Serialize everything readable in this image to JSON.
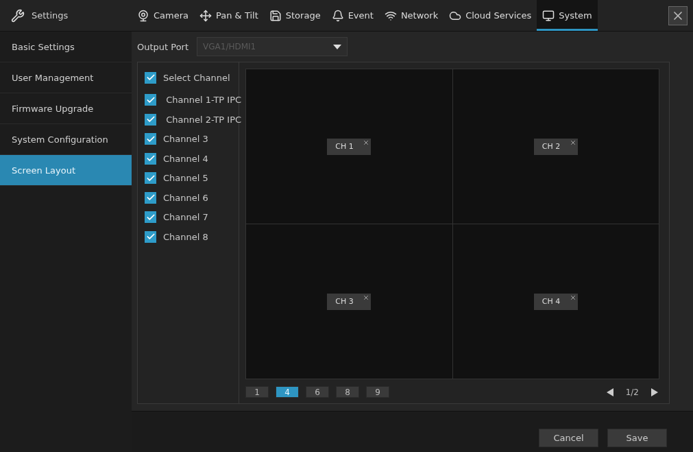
{
  "header": {
    "title": "Settings",
    "tabs": [
      {
        "label": "Camera",
        "selected": false
      },
      {
        "label": "Pan & Tilt",
        "selected": false
      },
      {
        "label": "Storage",
        "selected": false
      },
      {
        "label": "Event",
        "selected": false
      },
      {
        "label": "Network",
        "selected": false
      },
      {
        "label": "Cloud Services",
        "selected": false
      },
      {
        "label": "System",
        "selected": true
      }
    ]
  },
  "sidebar": {
    "items": [
      {
        "label": "Basic Settings",
        "selected": false
      },
      {
        "label": "User Management",
        "selected": false
      },
      {
        "label": "Firmware Upgrade",
        "selected": false
      },
      {
        "label": "System Configuration",
        "selected": false
      },
      {
        "label": "Screen Layout",
        "selected": true
      }
    ]
  },
  "output_port": {
    "label": "Output Port",
    "value": "VGA1/HDMI1",
    "disabled": true
  },
  "select_channel": {
    "label": "Select Channel",
    "checked": true
  },
  "channels": [
    {
      "label": " Channel 1-TP IPC",
      "checked": true
    },
    {
      "label": " Channel 2-TP IPC",
      "checked": true
    },
    {
      "label": "Channel 3",
      "checked": true
    },
    {
      "label": "Channel 4",
      "checked": true
    },
    {
      "label": "Channel 5",
      "checked": true
    },
    {
      "label": "Channel 6",
      "checked": true
    },
    {
      "label": "Channel 7",
      "checked": true
    },
    {
      "label": "Channel 8",
      "checked": true
    }
  ],
  "tiles": [
    {
      "label": "CH 1"
    },
    {
      "label": "CH 2"
    },
    {
      "label": "CH 3"
    },
    {
      "label": "CH 4"
    }
  ],
  "layouts": [
    {
      "label": "1",
      "selected": false
    },
    {
      "label": "4",
      "selected": true
    },
    {
      "label": "6",
      "selected": false
    },
    {
      "label": "8",
      "selected": false
    },
    {
      "label": "9",
      "selected": false
    }
  ],
  "pager": "1/2",
  "buttons": [
    "Cancel",
    "Save"
  ]
}
